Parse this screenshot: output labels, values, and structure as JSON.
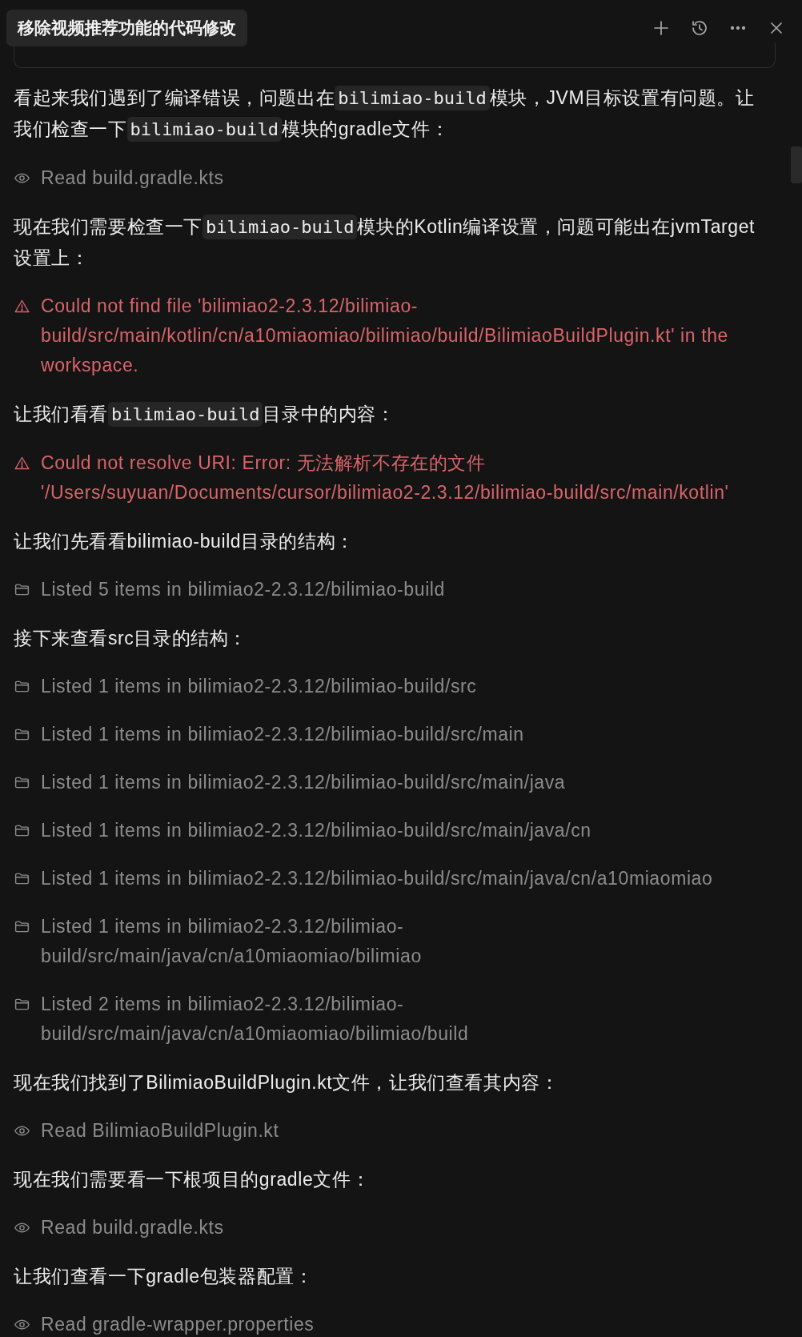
{
  "header": {
    "title": "移除视频推荐功能的代码修改",
    "actions": [
      {
        "kind": "plus"
      },
      {
        "kind": "history"
      },
      {
        "kind": "more"
      },
      {
        "kind": "close"
      }
    ]
  },
  "messages": [
    {
      "kind": "text",
      "parts": [
        {
          "kind": "text",
          "text": "看起来我们遇到了编译错误，问题出在"
        },
        {
          "kind": "code",
          "text": "bilimiao-build"
        },
        {
          "kind": "text",
          "text": "模块，JVM目标设置有问题。让我们检查一下"
        },
        {
          "kind": "code",
          "text": "bilimiao-build"
        },
        {
          "kind": "text",
          "text": "模块的gradle文件："
        }
      ]
    },
    {
      "kind": "read",
      "text": "Read build.gradle.kts"
    },
    {
      "kind": "text",
      "parts": [
        {
          "kind": "text",
          "text": "现在我们需要检查一下"
        },
        {
          "kind": "code",
          "text": "bilimiao-build"
        },
        {
          "kind": "text",
          "text": "模块的Kotlin编译设置，问题可能出在jvmTarget设置上："
        }
      ]
    },
    {
      "kind": "error",
      "text": "Could not find file 'bilimiao2-2.3.12/bilimiao-build/src/main/kotlin/cn/a10miaomiao/bilimiao/build/BilimiaoBuildPlugin.kt' in the workspace."
    },
    {
      "kind": "text",
      "parts": [
        {
          "kind": "text",
          "text": "让我们看看"
        },
        {
          "kind": "code",
          "text": "bilimiao-build"
        },
        {
          "kind": "text",
          "text": "目录中的内容："
        }
      ]
    },
    {
      "kind": "error",
      "text": "Could not resolve URI: Error: 无法解析不存在的文件 '/Users/suyuan/Documents/cursor/bilimiao2-2.3.12/bilimiao-build/src/main/kotlin'"
    },
    {
      "kind": "text",
      "parts": [
        {
          "kind": "text",
          "text": "让我们先看看bilimiao-build目录的结构："
        }
      ]
    },
    {
      "kind": "listed",
      "text": "Listed 5 items in bilimiao2-2.3.12/bilimiao-build"
    },
    {
      "kind": "text",
      "parts": [
        {
          "kind": "text",
          "text": "接下来查看src目录的结构："
        }
      ]
    },
    {
      "kind": "listed",
      "text": "Listed 1 items in bilimiao2-2.3.12/bilimiao-build/src"
    },
    {
      "kind": "listed",
      "text": "Listed 1 items in bilimiao2-2.3.12/bilimiao-build/src/main"
    },
    {
      "kind": "listed",
      "text": "Listed 1 items in bilimiao2-2.3.12/bilimiao-build/src/main/java"
    },
    {
      "kind": "listed",
      "text": "Listed 1 items in bilimiao2-2.3.12/bilimiao-build/src/main/java/cn"
    },
    {
      "kind": "listed",
      "text": "Listed 1 items in bilimiao2-2.3.12/bilimiao-build/src/main/java/cn/a10miaomiao"
    },
    {
      "kind": "listed",
      "text": "Listed 1 items in bilimiao2-2.3.12/bilimiao-build/src/main/java/cn/a10miaomiao/bilimiao"
    },
    {
      "kind": "listed",
      "text": "Listed 2 items in bilimiao2-2.3.12/bilimiao-build/src/main/java/cn/a10miaomiao/bilimiao/build"
    },
    {
      "kind": "text",
      "parts": [
        {
          "kind": "text",
          "text": "现在我们找到了BilimiaoBuildPlugin.kt文件，让我们查看其内容："
        }
      ]
    },
    {
      "kind": "read",
      "text": "Read BilimiaoBuildPlugin.kt"
    },
    {
      "kind": "text",
      "parts": [
        {
          "kind": "text",
          "text": "现在我们需要看一下根项目的gradle文件："
        }
      ]
    },
    {
      "kind": "read",
      "text": "Read build.gradle.kts"
    },
    {
      "kind": "text",
      "parts": [
        {
          "kind": "text",
          "text": "让我们查看一下gradle包装器配置："
        }
      ]
    },
    {
      "kind": "read",
      "text": "Read gradle-wrapper.properties"
    }
  ]
}
